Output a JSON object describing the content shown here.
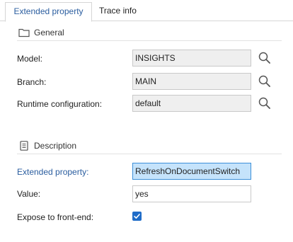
{
  "tabs": [
    {
      "label": "Extended property",
      "active": true
    },
    {
      "label": "Trace info",
      "active": false
    }
  ],
  "general": {
    "title": "General",
    "icon": "folder-icon",
    "rows": [
      {
        "label": "Model:",
        "value": "INSIGHTS"
      },
      {
        "label": "Branch:",
        "value": "MAIN"
      },
      {
        "label": "Runtime configuration:",
        "value": "default"
      }
    ]
  },
  "description": {
    "title": "Description",
    "icon": "document-icon",
    "extended_property": {
      "label": "Extended property:",
      "value": "RefreshOnDocumentSwitch"
    },
    "value": {
      "label": "Value:",
      "value": "yes"
    },
    "expose": {
      "label": "Expose to front-end:",
      "checked": true
    }
  },
  "colors": {
    "accent": "#2a5d9f",
    "selection": "#c5e3fb",
    "checkbox": "#1f6cc8"
  }
}
